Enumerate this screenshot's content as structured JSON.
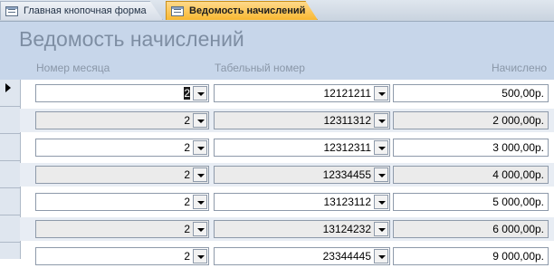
{
  "tabs": [
    {
      "label": "Главная кнопочная форма",
      "active": false
    },
    {
      "label": "Ведомость начислений",
      "active": true
    }
  ],
  "form": {
    "title": "Ведомость начислений",
    "columns": {
      "month": "Номер месяца",
      "tab_number": "Табельный номер",
      "amount": "Начислено"
    }
  },
  "rows": [
    {
      "month": "2",
      "tab_number": "12121211",
      "amount": "500,00р."
    },
    {
      "month": "2",
      "tab_number": "12311312",
      "amount": "2 000,00р."
    },
    {
      "month": "2",
      "tab_number": "12312311",
      "amount": "3 000,00р."
    },
    {
      "month": "2",
      "tab_number": "12334455",
      "amount": "4 000,00р."
    },
    {
      "month": "2",
      "tab_number": "13123112",
      "amount": "5 000,00р."
    },
    {
      "month": "2",
      "tab_number": "13124232",
      "amount": "6 000,00р."
    },
    {
      "month": "2",
      "tab_number": "23344445",
      "amount": "9 000,00р."
    }
  ],
  "colors": {
    "accent_tab": "#f8b832",
    "header_bg": "#c7d6ea",
    "alt_row": "#e8edf4"
  }
}
